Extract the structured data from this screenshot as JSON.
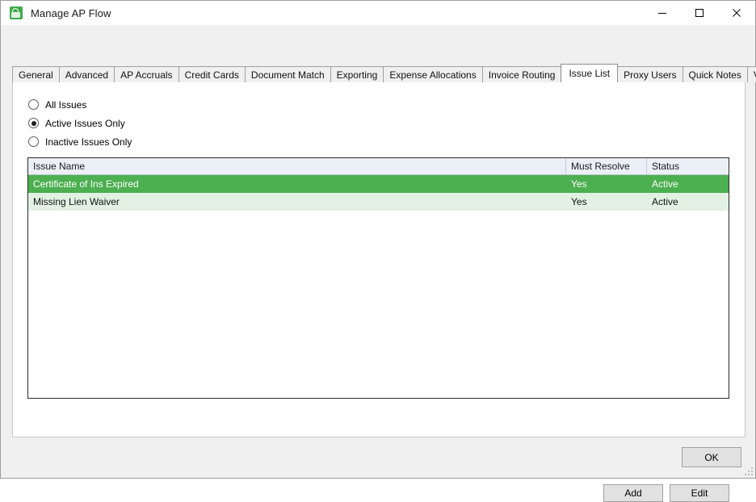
{
  "window": {
    "title": "Manage AP Flow",
    "icon": "app-lock-document-icon",
    "controls": {
      "minimize": "minimize-icon",
      "maximize": "maximize-icon",
      "close": "close-icon"
    }
  },
  "tabs": [
    {
      "label": "General",
      "active": false
    },
    {
      "label": "Advanced",
      "active": false
    },
    {
      "label": "AP Accruals",
      "active": false
    },
    {
      "label": "Credit Cards",
      "active": false
    },
    {
      "label": "Document Match",
      "active": false
    },
    {
      "label": "Exporting",
      "active": false
    },
    {
      "label": "Expense Allocations",
      "active": false
    },
    {
      "label": "Invoice Routing",
      "active": false
    },
    {
      "label": "Issue List",
      "active": true
    },
    {
      "label": "Proxy Users",
      "active": false
    },
    {
      "label": "Quick Notes",
      "active": false
    },
    {
      "label": "Validation",
      "active": false
    }
  ],
  "filter": {
    "options": [
      {
        "label": "All Issues",
        "checked": false
      },
      {
        "label": "Active Issues Only",
        "checked": true
      },
      {
        "label": "Inactive Issues Only",
        "checked": false
      }
    ]
  },
  "grid": {
    "columns": [
      "Issue Name",
      "Must Resolve",
      "Status"
    ],
    "rows": [
      {
        "name": "Certificate of Ins Expired",
        "must_resolve": "Yes",
        "status": "Active",
        "selected": true
      },
      {
        "name": "Missing Lien Waiver",
        "must_resolve": "Yes",
        "status": "Active",
        "selected": false
      }
    ]
  },
  "buttons": {
    "add": "Add",
    "edit": "Edit",
    "ok": "OK"
  },
  "colors": {
    "selected_row": "#4CAF50",
    "alt_row": "#E3F1E4",
    "header": "#EAF0F6",
    "dialog_face": "#F0F0F0",
    "accent_icon": "#3FAA4B"
  }
}
